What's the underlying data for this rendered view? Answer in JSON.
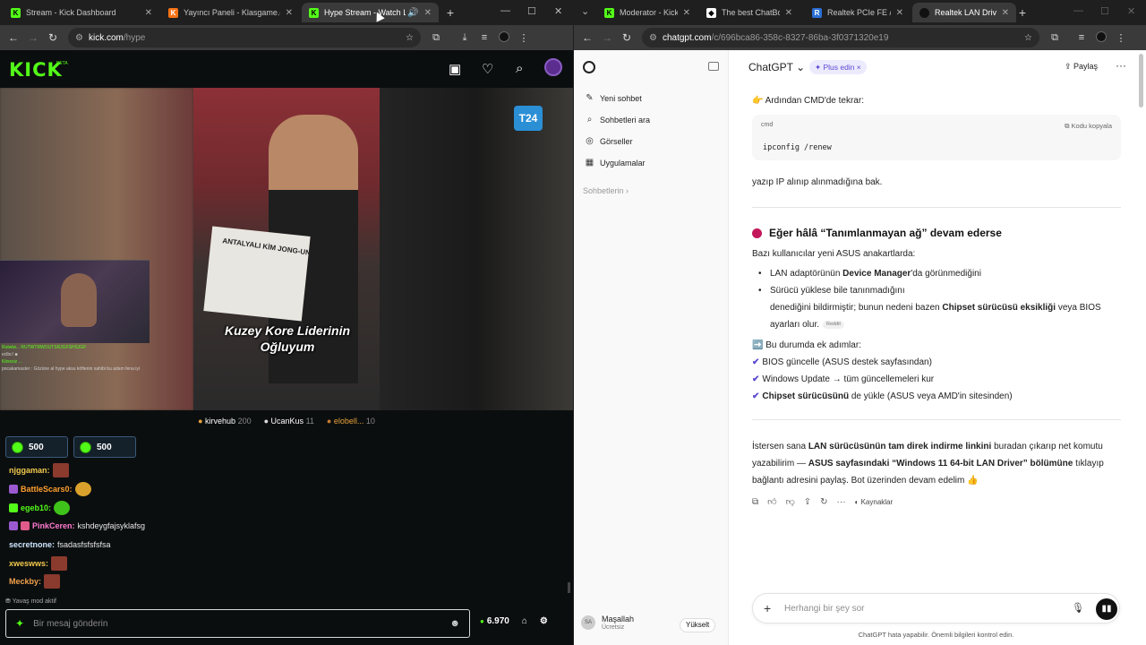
{
  "left": {
    "tabs": [
      {
        "title": "Stream - Kick Dashboard",
        "fav": "K",
        "color": "#53fc18"
      },
      {
        "title": "Yayıncı Paneli - Klasgame.com",
        "fav": "K",
        "color": "#f97316"
      },
      {
        "title": "Hype Stream - Watch Live",
        "fav": "K",
        "color": "#53fc18"
      }
    ],
    "url_host": "kick.com",
    "url_path": "/hype",
    "logo": "KICK",
    "logo_beta": "BETA",
    "video": {
      "caption": "Kuzey Kore Liderinin Oğluyum",
      "channel_bug": "T24",
      "paper_text": "ANTALYALI KİM JONG-UN"
    },
    "overlay_chat": [
      "Rutwlw... RUTWTRWOUTSRJGFSHSJGF",
      "eclbc! ■",
      "Kiinesiz ...",
      "pocakamaster : Gözüne al hype aksu köftenin sahibi bu adam fena iyi"
    ],
    "gifters": [
      {
        "name": "kirvehub",
        "count": "200"
      },
      {
        "name": "UcanKus",
        "count": "11"
      },
      {
        "name": "elobell...",
        "count": "10"
      }
    ],
    "kicks": [
      {
        "amount": "500"
      },
      {
        "amount": "500"
      }
    ],
    "chat": [
      {
        "user": "njggaman:",
        "text": "",
        "color": "#f2c94c"
      },
      {
        "user": "BattleScars0:",
        "text": "",
        "color": "#ff9f2e"
      },
      {
        "user": "egeb10:",
        "text": "",
        "color": "#53fc18"
      },
      {
        "user": "PinkCeren:",
        "text": "kshdeygfajsyklafsg",
        "color": "#ff7bd1"
      },
      {
        "user": "secretnone:",
        "text": "fsadasfsfsfsfsa",
        "color": "#cfe6ff"
      },
      {
        "user": "xweswws:",
        "text": "",
        "color": "#f2c94c"
      },
      {
        "user": "Meckby:",
        "text": "",
        "color": "#f2a14c"
      }
    ],
    "slow_mode": "Yavaş mod aktif",
    "chat_placeholder": "Bir mesaj gönderin",
    "points": "6.970"
  },
  "right": {
    "tabs": [
      {
        "title": "Moderator - Kick D",
        "color": "#53fc18"
      },
      {
        "title": "The best ChatBot a",
        "color": "#ffffff"
      },
      {
        "title": "Realtek PCIe FE / GB",
        "color": "#2b6fd6"
      },
      {
        "title": "Realtek LAN Driver",
        "color": "#111111"
      }
    ],
    "url_host": "chatgpt.com",
    "url_path": "/c/696bca86-358c-8327-86ba-3f0371320e19",
    "sidebar": {
      "items": [
        {
          "label": "Yeni sohbet",
          "icon": "✎"
        },
        {
          "label": "Sohbetleri ara",
          "icon": "⌕"
        },
        {
          "label": "Görseller",
          "icon": "◎"
        },
        {
          "label": "Uygulamalar",
          "icon": "▦"
        }
      ],
      "section": "Sohbetlerin ›",
      "user_name": "Maşallah",
      "user_plan": "Ücretsiz",
      "user_initials": "SA",
      "upgrade": "Yükselt"
    },
    "header": {
      "model": "ChatGPT ⌄",
      "plus": "✦ Plus edin  ×",
      "share": "⇪ Paylaş",
      "more": "···"
    },
    "content": {
      "cmd_intro": "👉 Ardından CMD'de tekrar:",
      "code_lang": "cmd",
      "code_copy": "⧉ Kodu kopyala",
      "code": "ipconfig /renew",
      "after_code": "yazıp IP alınıp alınmadığına bak.",
      "heading": "Eğer hâlâ “Tanımlanmayan ağ” devam ederse",
      "intro": "Bazı kullanıcılar yeni ASUS anakartlarda:",
      "bullet1_pre": "LAN adaptörünün ",
      "bullet1_bold": "Device Manager",
      "bullet1_post": "'da görünmediğini",
      "bullet2_line1": "Sürücü yüklese bile tanınmadığını",
      "bullet2_line2_pre": "denediğini bildirmiştir; bunun nedeni bazen ",
      "bullet2_line2_bold": "Chipset sürücüsü eksikliği",
      "bullet2_line2_post": " veya BIOS",
      "bullet2_line3": "ayarları olur.",
      "source_pill": "Reddit",
      "steps_title": "➡️ Bu durumda ek adımlar:",
      "step1": "BIOS güncelle (ASUS destek sayfasından)",
      "step2": "Windows Update → tüm güncellemeleri kur",
      "step3_bold": "Chipset sürücüsünü",
      "step3_post": " de yükle (ASUS veya AMD'in sitesinden)",
      "final_l1_pre": "İstersen sana ",
      "final_l1_bold": "LAN sürücüsünün tam direk indirme linkini",
      "final_l1_post": " buradan çıkarıp net komutu",
      "final_l2_pre": "yazabilirim — ",
      "final_l2_bold": "ASUS sayfasındaki “Windows 11 64-bit LAN Driver” bölümüne",
      "final_l2_post": " tıklayıp",
      "final_l3": "bağlantı adresini paylaş. Bot üzerinden devam edelim 👍",
      "sources": "Kaynaklar"
    },
    "composer": {
      "placeholder": "Herhangi bir şey sor"
    },
    "disclaimer": "ChatGPT hata yapabilir. Önemli bilgileri kontrol edin."
  }
}
